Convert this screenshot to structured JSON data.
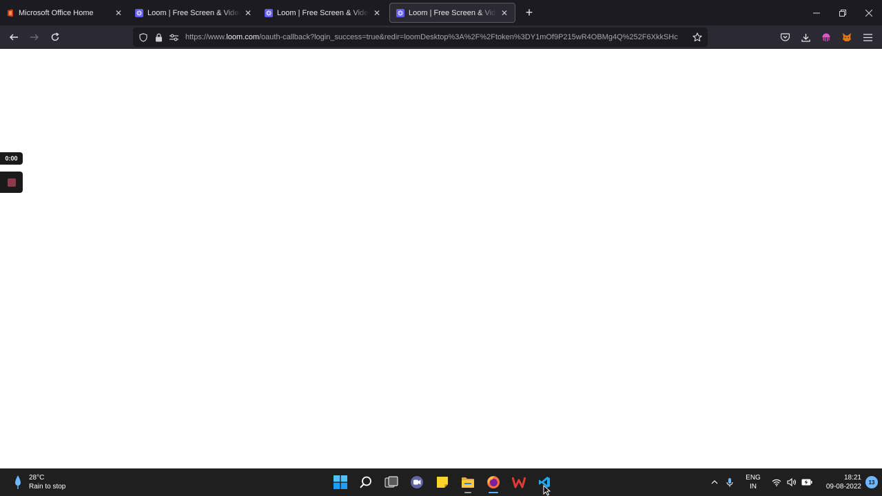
{
  "browser": {
    "tabs": [
      {
        "title": "Microsoft Office Home",
        "icon": "office-icon",
        "active": false
      },
      {
        "title": "Loom | Free Screen & Video Recording",
        "icon": "loom-icon",
        "active": false
      },
      {
        "title": "Loom | Free Screen & Video Recording",
        "icon": "loom-icon",
        "active": false
      },
      {
        "title": "Loom | Free Screen & Video Recording",
        "icon": "loom-icon",
        "active": true
      }
    ],
    "url": {
      "prefix": "https://www.",
      "domain": "loom.com",
      "path": "/oauth-callback?login_success=true&redir=loomDesktop%3A%2F%2Ftoken%3DY1mOf9P215wR4OBMg4Q%252F6XkkSHc"
    }
  },
  "loom": {
    "timer": "0:00"
  },
  "taskbar": {
    "weather": {
      "temp": "28°C",
      "desc": "Rain to stop"
    },
    "language": {
      "line1": "ENG",
      "line2": "IN"
    },
    "clock": {
      "time": "18:21",
      "date": "09-08-2022"
    },
    "notifications": "13"
  },
  "colors": {
    "tabstrip_bg": "#1c1b22",
    "toolbar_bg": "#2b2a33",
    "taskbar_bg": "#1f1f1f",
    "accent": "#5fb2ff",
    "loom_stop": "#8c3b4b"
  }
}
